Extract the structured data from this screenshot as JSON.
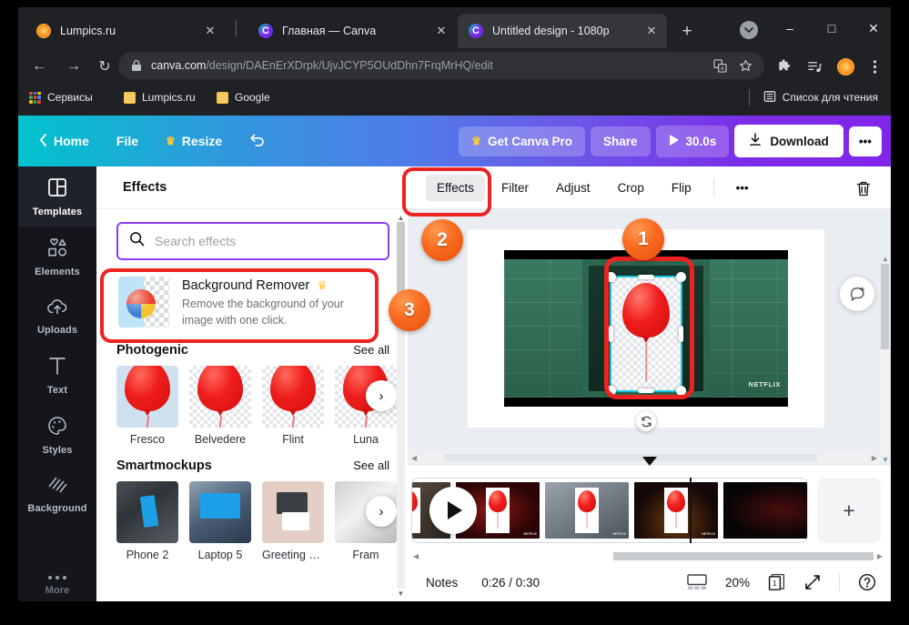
{
  "browser": {
    "tabs": [
      {
        "title": "Lumpics.ru",
        "favicon": "orange-slice-icon",
        "active": false
      },
      {
        "title": "Главная — Canva",
        "favicon": "canva-icon",
        "active": false
      },
      {
        "title": "Untitled design - 1080p",
        "favicon": "canva-icon",
        "active": true
      }
    ],
    "new_tab_label": "+",
    "window_controls": {
      "minimize": "–",
      "maximize": "□",
      "close": "✕"
    },
    "nav": {
      "back": "←",
      "forward": "→",
      "reload": "↻"
    },
    "omnibox": {
      "lock_icon": "lock-icon",
      "url_domain": "canva.com",
      "url_path": "/design/DAEnErXDrpk/UjvJCYP5OUdDhn7FrqMrHQ/edit",
      "translate_icon": "translate-icon",
      "bookmark_icon": "star-icon"
    },
    "toolbar_icons": [
      "extensions-icon",
      "media-list-icon",
      "profile-avatar-icon",
      "chrome-menu-icon"
    ],
    "bookmarks": [
      {
        "label": "Сервисы",
        "icon": "apps-grid-icon"
      },
      {
        "label": "Lumpics.ru",
        "icon": "folder-icon"
      },
      {
        "label": "Google",
        "icon": "folder-icon"
      }
    ],
    "reading_list": {
      "label": "Список для чтения",
      "icon": "reading-list-icon"
    }
  },
  "canva_topbar": {
    "back_icon": "chevron-left-icon",
    "home": "Home",
    "file": "File",
    "resize": "Resize",
    "resize_icon": "crown-icon",
    "undo_icon": "undo-icon",
    "get_pro": "Get Canva Pro",
    "get_pro_icon": "crown-icon",
    "share": "Share",
    "play_icon": "play-icon",
    "duration": "30.0s",
    "download": "Download",
    "download_icon": "download-icon",
    "more": "•••"
  },
  "rail": {
    "items": [
      {
        "label": "Templates",
        "icon": "templates-icon",
        "active": true
      },
      {
        "label": "Elements",
        "icon": "elements-icon",
        "active": false
      },
      {
        "label": "Uploads",
        "icon": "upload-cloud-icon",
        "active": false
      },
      {
        "label": "Text",
        "icon": "text-icon",
        "active": false
      },
      {
        "label": "Styles",
        "icon": "styles-palette-icon",
        "active": false
      },
      {
        "label": "Background",
        "icon": "background-icon",
        "active": false
      }
    ],
    "more_label": "More",
    "more_icon": "three-dots-icon"
  },
  "panel": {
    "title": "Effects",
    "search": {
      "placeholder": "Search effects",
      "value": "",
      "icon": "search-icon"
    },
    "background_remover": {
      "name": "Background Remover",
      "pro_icon": "crown-icon",
      "description": "Remove the background of your image with one click.",
      "thumb": "beach-ball-icon"
    },
    "sections": [
      {
        "title": "Photogenic",
        "see_all": "See all",
        "items": [
          {
            "label": "Fresco"
          },
          {
            "label": "Belvedere"
          },
          {
            "label": "Flint"
          },
          {
            "label": "Luna"
          }
        ],
        "next_icon": "chevron-right-icon"
      },
      {
        "title": "Smartmockups",
        "see_all": "See all",
        "items": [
          {
            "label": "Phone 2"
          },
          {
            "label": "Laptop 5"
          },
          {
            "label": "Greeting car..."
          },
          {
            "label": "Fram"
          }
        ],
        "next_icon": "chevron-right-icon"
      }
    ]
  },
  "editor": {
    "subbar": {
      "tabs": [
        {
          "label": "Effects",
          "active": true
        },
        {
          "label": "Filter",
          "active": false
        },
        {
          "label": "Adjust",
          "active": false
        },
        {
          "label": "Crop",
          "active": false
        },
        {
          "label": "Flip",
          "active": false
        }
      ],
      "more": "•••",
      "delete_icon": "trash-icon"
    },
    "canvas": {
      "watermark": "NETFLIX",
      "rotate_icon": "rotate-icon",
      "comment_icon": "add-comment-icon"
    },
    "timeline": {
      "play_icon": "play-icon",
      "add_page_icon": "plus-icon",
      "clips": 5
    },
    "status": {
      "notes": "Notes",
      "time": "0:26 / 0:30",
      "view_icon": "page-view-icon",
      "zoom": "20%",
      "pages_icon": "pages-icon",
      "page_number": "1",
      "fullscreen_icon": "expand-icon",
      "help_icon": "help-icon"
    }
  },
  "annotations": {
    "badges": [
      {
        "label": "1"
      },
      {
        "label": "2"
      },
      {
        "label": "3"
      }
    ],
    "highlight_color": "#ef2222"
  }
}
